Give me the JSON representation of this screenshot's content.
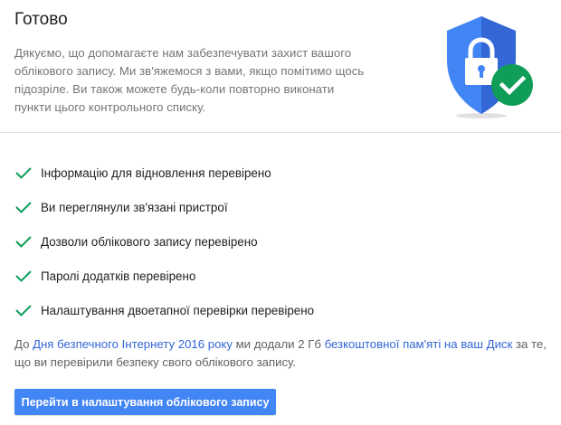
{
  "header": {
    "title": "Готово",
    "description": "Дякуємо, що допомагаєте нам забезпечувати захист вашого облікового запису. Ми зв'яжемося з вами, якщо помітимо щось підозріле. Ви також можете будь-коли повторно виконати пункти цього контрольного списку."
  },
  "illustration": {
    "icon": "shield-lock-check-icon",
    "colors": {
      "shield_left": "#4285f4",
      "shield_right": "#3367d6",
      "lock": "#ffffff",
      "check_badge": "#0f9d58",
      "shadow": "#e0e0e0"
    }
  },
  "checklist": {
    "check_color": "#0f9d58",
    "items": [
      {
        "label": "Інформацію для відновлення перевірено",
        "icon": "check-icon"
      },
      {
        "label": "Ви переглянули зв'язані пристрої",
        "icon": "check-icon"
      },
      {
        "label": "Дозволи облікового запису перевірено",
        "icon": "check-icon"
      },
      {
        "label": "Паролі додатків перевірено",
        "icon": "check-icon"
      },
      {
        "label": "Налаштування двоетапної перевірки перевірено",
        "icon": "check-icon"
      }
    ]
  },
  "note": {
    "part1": "До ",
    "link1": "Дня безпечного Інтернету 2016 року",
    "part2": " ми додали 2 Гб ",
    "link2": "безкоштовної пам'яті на ваш Диск",
    "part3": " за те, що ви перевірили безпеку свого облікового запису.",
    "link_color": "#3367d6"
  },
  "actions": {
    "primary_label": "Перейти в налаштування облікового запису",
    "primary_color": "#4285f4"
  }
}
